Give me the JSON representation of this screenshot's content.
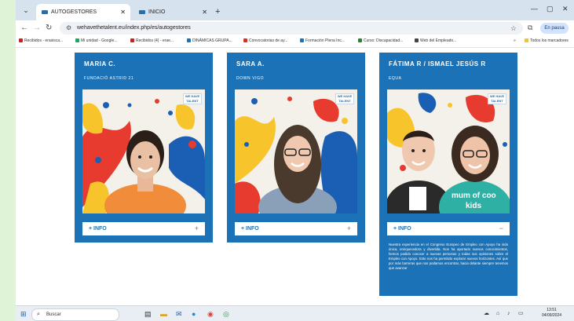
{
  "browser": {
    "tabs": [
      {
        "label": "AUTOGESTORES",
        "active": true
      },
      {
        "label": "INICIO",
        "active": false
      }
    ],
    "new_tab": "+",
    "url": "wehavethetalent.eu/index.php/es/autogestores",
    "pause_label": "En pausa",
    "bookmarks": [
      {
        "label": "Recibidos - erasisca...",
        "color": "#c5221f"
      },
      {
        "label": "Mi unidad - Google...",
        "color": "#1fa463"
      },
      {
        "label": "Recibidos (4) - erae...",
        "color": "#c5221f"
      },
      {
        "label": "DINÁMICAS GRUPA...",
        "color": "#1b72b6"
      },
      {
        "label": "Convocatorias de ay...",
        "color": "#d93025"
      },
      {
        "label": "Formación Plena Inc...",
        "color": "#1b72b6"
      },
      {
        "label": "Curso: Discapacidad...",
        "color": "#2e7d32"
      },
      {
        "label": "Web del Empleado...",
        "color": "#444444"
      }
    ],
    "all_bookmarks": "Todos los marcadores"
  },
  "cards": [
    {
      "name": "MARIA C.",
      "org": "FUNDACIÓ ASTRID 21",
      "info": "+ INFO",
      "toggle": "+",
      "expanded": false
    },
    {
      "name": "SARA A.",
      "org": "DOWN VIGO",
      "info": "+ INFO",
      "toggle": "+",
      "expanded": false
    },
    {
      "name": "FÁTIMA R / ISMAEL JESÚS R",
      "org": "EQUA",
      "info": "+ INFO",
      "toggle": "−",
      "expanded": true,
      "description": "Nuestra experiencia en el Congreso Europeo de Empleo con Apoyo ha sido única, enriquecedora y divertida. Nos ha aportado nuevos conocimientos, hemos podido conocer a nuevas personas y todas sus opiniones sobre el Empleo con Apoyo. Esto nos ha permitido explorar nuevos horizontes. Así que por más barreras que nos podamos encontrar, hacia delante siempre tenemos que avanzar",
      "shirt_text": "mum of coo kids"
    }
  ],
  "logo_text": "WE HAVE THE TALENT",
  "taskbar": {
    "search_placeholder": "Buscar",
    "time": "13:51",
    "date": "04/09/2024"
  },
  "colors": {
    "brand_blue": "#1b72b6"
  }
}
